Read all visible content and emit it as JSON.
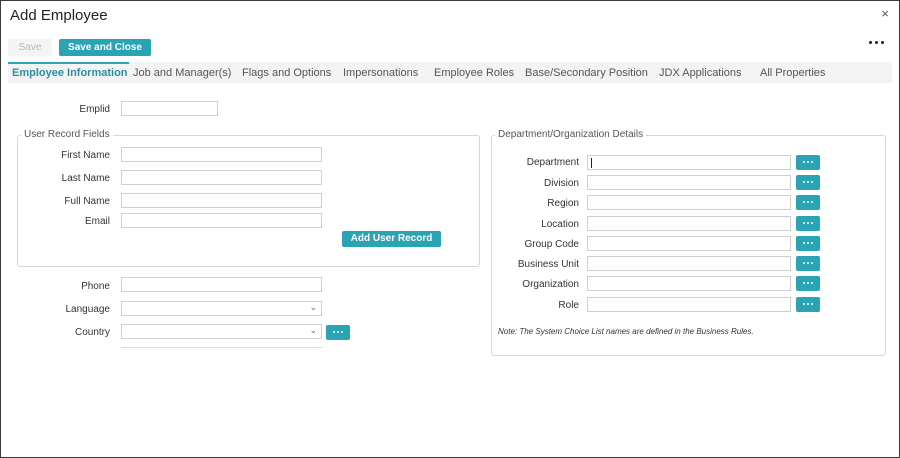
{
  "window": {
    "title": "Add Employee",
    "close_glyph": "×"
  },
  "toolbar": {
    "save_label": "Save",
    "save_close_label": "Save and Close"
  },
  "tabs": [
    {
      "label": "Employee Information",
      "active": true
    },
    {
      "label": "Job and Manager(s)"
    },
    {
      "label": "Flags and Options"
    },
    {
      "label": "Impersonations"
    },
    {
      "label": "Employee Roles"
    },
    {
      "label": "Base/Secondary Position"
    },
    {
      "label": "JDX Applications"
    },
    {
      "label": "All Properties"
    }
  ],
  "form": {
    "emplid_label": "Emplid",
    "user_record": {
      "legend": "User Record Fields",
      "first_name_label": "First Name",
      "last_name_label": "Last Name",
      "full_name_label": "Full Name",
      "email_label": "Email",
      "add_button": "Add User Record"
    },
    "phone_label": "Phone",
    "language_label": "Language",
    "country_label": "Country"
  },
  "department": {
    "legend": "Department/Organization Details",
    "fields": [
      "Department",
      "Division",
      "Region",
      "Location",
      "Group Code",
      "Business Unit",
      "Organization",
      "Role"
    ],
    "note": "Note: The System Choice List names are defined in the Business Rules."
  },
  "icons": {
    "more": "more-options-icon",
    "picker": "ellipsis-icon",
    "dropdown": "chevron-down-icon"
  },
  "colors": {
    "accent": "#2aa3b5"
  }
}
